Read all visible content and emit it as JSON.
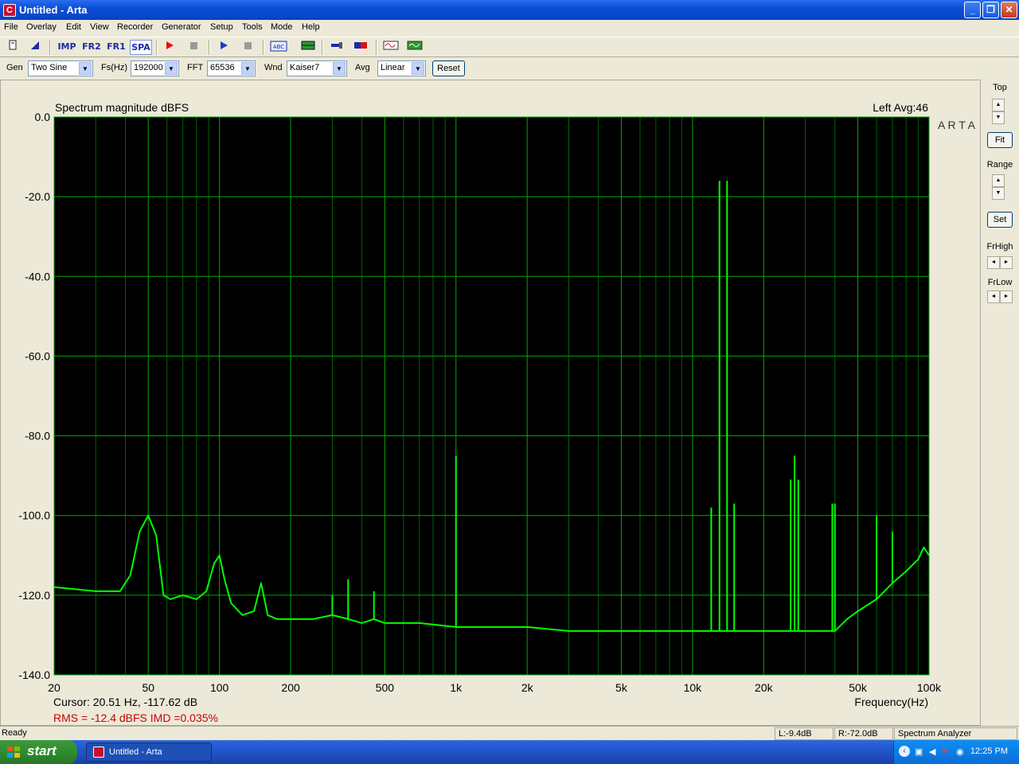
{
  "window": {
    "title": "Untitled - Arta",
    "app_icon_letter": "C"
  },
  "menu": [
    "File",
    "Overlay",
    "Edit",
    "View",
    "Recorder",
    "Generator",
    "Setup",
    "Tools",
    "Mode",
    "Help"
  ],
  "toolbar": {
    "imp_label": "IMP",
    "fr2_label": "FR2",
    "fr1_label": "FR1",
    "spa_label": "SPA",
    "abc_label": "ABC"
  },
  "controls": {
    "gen_label": "Gen",
    "gen_value": "Two Sine",
    "fs_label": "Fs(Hz)",
    "fs_value": "192000",
    "fft_label": "FFT",
    "fft_value": "65536",
    "wnd_label": "Wnd",
    "wnd_value": "Kaiser7",
    "avg_label": "Avg",
    "avg_value": "Linear",
    "reset_label": "Reset"
  },
  "side": {
    "top_label": "Top",
    "fit_label": "Fit",
    "range_label": "Range",
    "set_label": "Set",
    "frhigh_label": "FrHigh",
    "frlow_label": "FrLow"
  },
  "plot": {
    "title": "Spectrum magnitude dBFS",
    "channel": "Left  Avg:46",
    "watermark": "A R T A",
    "cursor_text": "Cursor: 20.51 Hz, -117.62 dB",
    "rms_text": "RMS =  -12.4 dBFS   IMD =0.035%",
    "x_axis_label": "Frequency(Hz)",
    "colors": {
      "trace": "#00ff00",
      "grid": "#00aa00",
      "minor_grid": "#006600",
      "background": "#000000",
      "red_text": "#cc0000"
    }
  },
  "chart_data": {
    "type": "line",
    "title": "Spectrum magnitude dBFS",
    "xlabel": "Frequency(Hz)",
    "ylabel": "",
    "x_scale": "log",
    "xlim": [
      20,
      100000
    ],
    "ylim": [
      -140,
      0
    ],
    "x_ticks": [
      20,
      50,
      100,
      200,
      500,
      1000,
      2000,
      5000,
      10000,
      20000,
      50000,
      100000
    ],
    "x_tick_labels": [
      "20",
      "50",
      "100",
      "200",
      "500",
      "1k",
      "2k",
      "5k",
      "10k",
      "20k",
      "50k",
      "100k"
    ],
    "y_ticks": [
      0,
      -20,
      -40,
      -60,
      -80,
      -100,
      -120,
      -140
    ],
    "y_tick_labels": [
      "0.0",
      "-20.0",
      "-40.0",
      "-60.0",
      "-80.0",
      "-100.0",
      "-120.0",
      "-140.0"
    ],
    "grid": true,
    "series": [
      {
        "name": "",
        "color": "#00ff00",
        "x": [
          20,
          30,
          38,
          42,
          46,
          50,
          54,
          58,
          62,
          70,
          80,
          88,
          95,
          100,
          105,
          112,
          125,
          140,
          150,
          160,
          175,
          200,
          250,
          300,
          350,
          400,
          450,
          500,
          700,
          1000,
          1500,
          2000,
          3000,
          5000,
          8000,
          10000,
          15000,
          20000,
          25000,
          30000,
          35000,
          40000,
          45000,
          50000,
          60000,
          70000,
          80000,
          90000,
          95000,
          100000
        ],
        "y": [
          -118,
          -119,
          -119,
          -115,
          -104,
          -100,
          -105,
          -120,
          -121,
          -120,
          -121,
          -119,
          -112,
          -110,
          -116,
          -122,
          -125,
          -124,
          -117,
          -125,
          -126,
          -126,
          -126,
          -125,
          -126,
          -127,
          -126,
          -127,
          -127,
          -128,
          -128,
          -128,
          -129,
          -129,
          -129,
          -129,
          -129,
          -129,
          -129,
          -129,
          -129,
          -129,
          -126,
          -124,
          -121,
          -117,
          -114,
          -111,
          -108,
          -110
        ]
      }
    ],
    "peaks": [
      {
        "x": 50,
        "y": -100
      },
      {
        "x": 100,
        "y": -110
      },
      {
        "x": 150,
        "y": -117
      },
      {
        "x": 300,
        "y": -120
      },
      {
        "x": 350,
        "y": -116
      },
      {
        "x": 450,
        "y": -119
      },
      {
        "x": 1000,
        "y": -85
      },
      {
        "x": 12000,
        "y": -98
      },
      {
        "x": 13000,
        "y": -16
      },
      {
        "x": 14000,
        "y": -16
      },
      {
        "x": 15000,
        "y": -97
      },
      {
        "x": 26000,
        "y": -91
      },
      {
        "x": 27000,
        "y": -85
      },
      {
        "x": 28000,
        "y": -91
      },
      {
        "x": 39000,
        "y": -97
      },
      {
        "x": 40000,
        "y": -97
      },
      {
        "x": 60000,
        "y": -100
      },
      {
        "x": 70000,
        "y": -104
      }
    ]
  },
  "status": {
    "left": "Ready",
    "l_level": "L:-9.4dB",
    "r_level": "R:-72.0dB",
    "mode": "Spectrum Analyzer"
  },
  "taskbar": {
    "start_label": "start",
    "task_label": "Untitled - Arta",
    "clock": "12:25 PM"
  }
}
